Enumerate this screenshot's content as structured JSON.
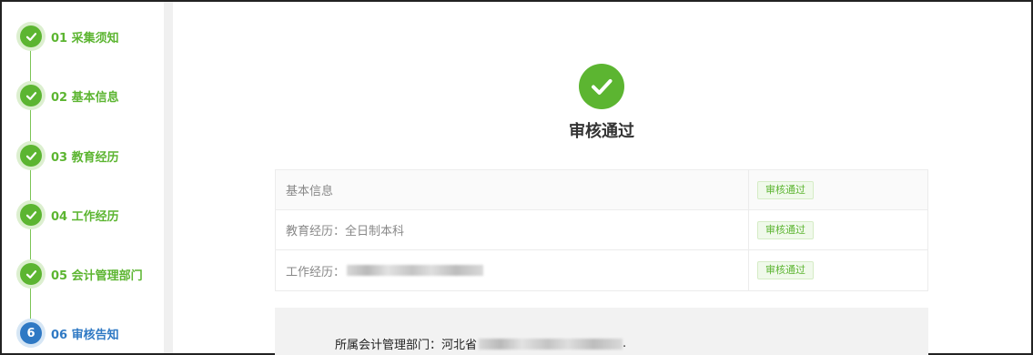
{
  "steps": [
    {
      "number": "01",
      "label": "采集须知",
      "state": "done"
    },
    {
      "number": "02",
      "label": "基本信息",
      "state": "done"
    },
    {
      "number": "03",
      "label": "教育经历",
      "state": "done"
    },
    {
      "number": "04",
      "label": "工作经历",
      "state": "done"
    },
    {
      "number": "05",
      "label": "会计管理部门",
      "state": "done"
    },
    {
      "number": "06",
      "label": "审核告知",
      "state": "active",
      "badge": "6"
    }
  ],
  "result": {
    "title": "审核通过",
    "icon": "check-circle-icon"
  },
  "review_items": [
    {
      "item": "基本信息",
      "status": "审核通过"
    },
    {
      "item": "教育经历：全日制本科",
      "status": "审核通过"
    },
    {
      "item": "工作经历：",
      "status": "审核通过"
    }
  ],
  "department": {
    "label": "所属会计管理部门：河北省",
    "trailing": "."
  },
  "colors": {
    "success": "#5cb531",
    "active": "#2f79c4"
  }
}
